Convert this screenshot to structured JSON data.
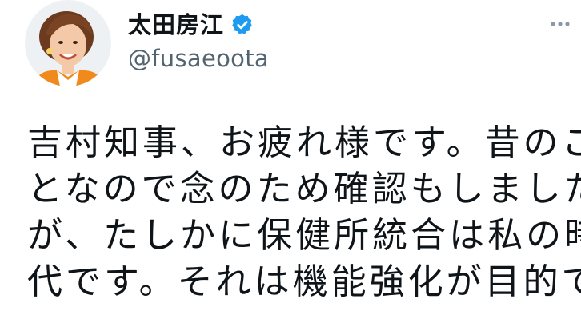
{
  "author": {
    "display_name": "太田房江",
    "handle": "@fusaeoota",
    "verified": true
  },
  "tweet": {
    "lines": [
      "吉村知事、お疲れ様です。昔のこ",
      "となので念のため確認もしました",
      "が、たしかに保健所統合は私の時",
      "代です。それは機能強化が目的で"
    ]
  },
  "icons": {
    "verified": "verified-badge-icon",
    "more": "more-dots-icon"
  },
  "colors": {
    "text": "#0f1419",
    "secondary": "#536471",
    "verified_blue": "#1d9bf0",
    "avatar_bg": "#eef1f4"
  }
}
